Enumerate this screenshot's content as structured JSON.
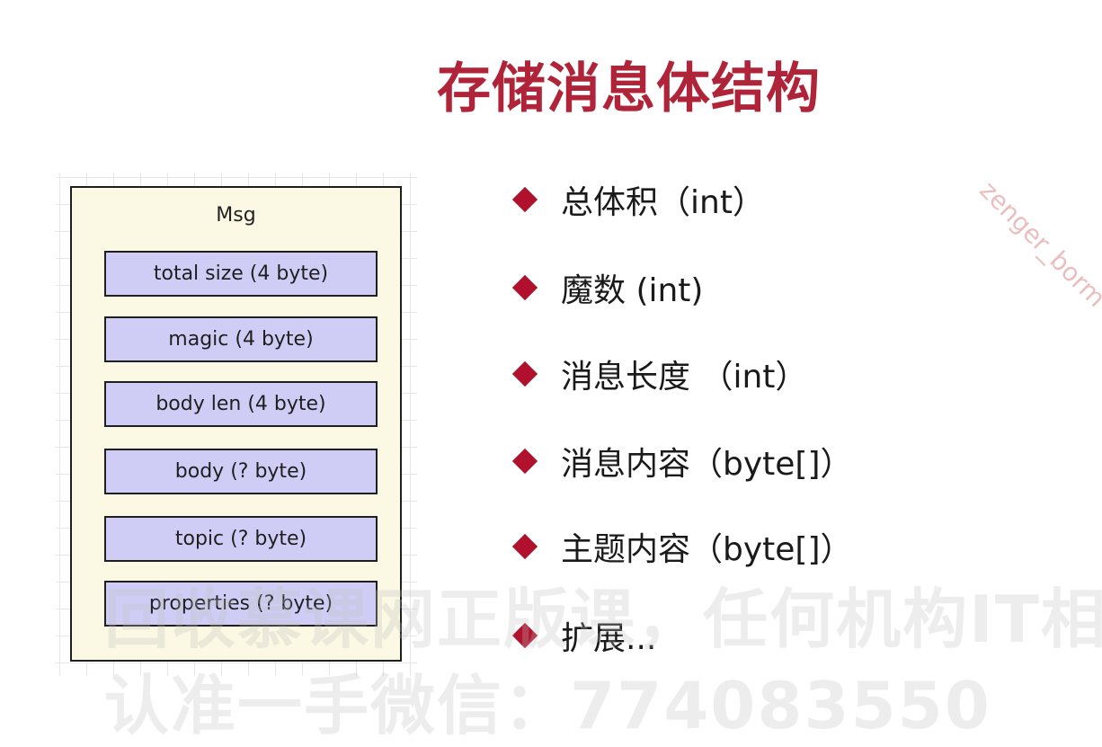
{
  "slide": {
    "title": "存储消息体结构"
  },
  "diagram": {
    "container_label": "Msg",
    "fields": [
      "total size (4 byte)",
      "magic (4 byte)",
      "body len (4 byte)",
      "body (? byte)",
      "topic (? byte)",
      "properties (? byte)"
    ]
  },
  "bullets": [
    "总体积（int）",
    "魔数 (int)",
    "消息长度 （int）",
    "消息内容（byte[]）",
    "主题内容（byte[]）",
    "扩展..."
  ],
  "watermarks": {
    "diagonal": "zenger_borm",
    "line1": "回收慕课网正版课，任何机构IT相关的正版",
    "line2": "认准一手微信：774083550"
  },
  "colors": {
    "title": "#b0243a",
    "bullet_diamond": "#b0122e",
    "container_fill": "#fbf8e4",
    "field_fill": "#cfcdf6"
  }
}
